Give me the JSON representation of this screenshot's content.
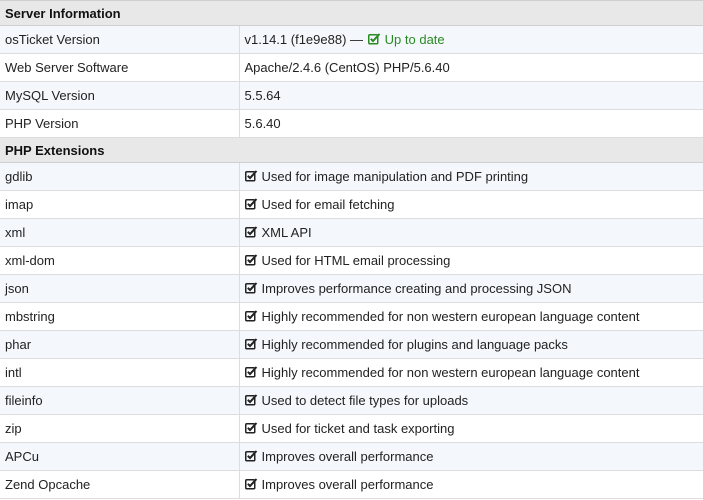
{
  "server_info": {
    "heading": "Server Information",
    "rows": [
      {
        "name": "osTicket Version",
        "value": "v1.14.1 (f1e9e88) —",
        "status": "Up to date"
      },
      {
        "name": "Web Server Software",
        "value": "Apache/2.4.6 (CentOS) PHP/5.6.40"
      },
      {
        "name": "MySQL Version",
        "value": "5.5.64"
      },
      {
        "name": "PHP Version",
        "value": "5.6.40"
      }
    ]
  },
  "php_extensions": {
    "heading": "PHP Extensions",
    "rows": [
      {
        "name": "gdlib",
        "description": "Used for image manipulation and PDF printing"
      },
      {
        "name": "imap",
        "description": "Used for email fetching"
      },
      {
        "name": "xml",
        "description": "XML API"
      },
      {
        "name": "xml-dom",
        "description": "Used for HTML email processing"
      },
      {
        "name": "json",
        "description": "Improves performance creating and processing JSON"
      },
      {
        "name": "mbstring",
        "description": "Highly recommended for non western european language content"
      },
      {
        "name": "phar",
        "description": "Highly recommended for plugins and language packs"
      },
      {
        "name": "intl",
        "description": "Highly recommended for non western european language content"
      },
      {
        "name": "fileinfo",
        "description": "Used to detect file types for uploads"
      },
      {
        "name": "zip",
        "description": "Used for ticket and task exporting"
      },
      {
        "name": "APCu",
        "description": "Improves overall performance"
      },
      {
        "name": "Zend Opcache",
        "description": "Improves overall performance"
      }
    ]
  },
  "icons": {
    "check": "check-square-icon",
    "check_color": "#222222",
    "ok_color": "#2a8a24"
  }
}
